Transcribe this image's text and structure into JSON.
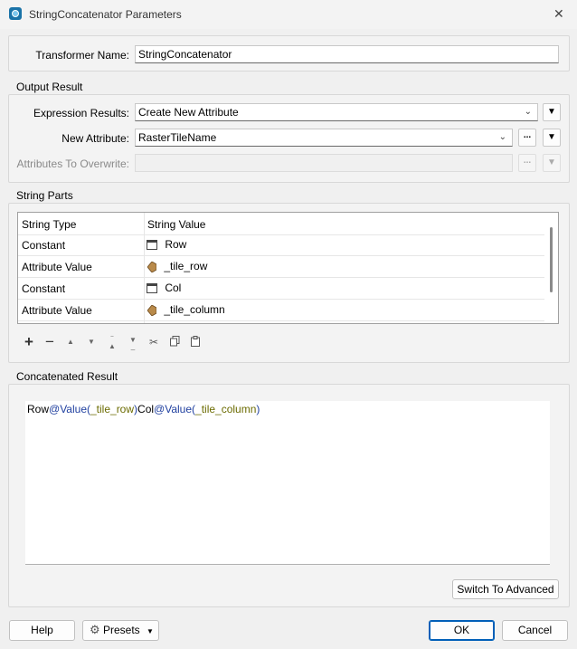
{
  "window": {
    "title": "StringConcatenator Parameters",
    "close_glyph": "✕"
  },
  "transformer": {
    "label": "Transformer Name:",
    "value": "StringConcatenator"
  },
  "output_result": {
    "section_title": "Output Result",
    "expression_results": {
      "label": "Expression Results:",
      "value": "Create New Attribute"
    },
    "new_attribute": {
      "label": "New Attribute:",
      "value": "RasterTileName",
      "ellipsis": "..."
    },
    "attributes_to_overwrite": {
      "label": "Attributes To Overwrite:",
      "value": "",
      "ellipsis": "..."
    }
  },
  "string_parts": {
    "section_title": "String Parts",
    "columns": [
      "String Type",
      "String Value"
    ],
    "rows": [
      {
        "type": "Constant",
        "value": "Row",
        "icon": "constant-icon"
      },
      {
        "type": "Attribute Value",
        "value": "_tile_row",
        "icon": "attribute-icon"
      },
      {
        "type": "Constant",
        "value": "Col",
        "icon": "constant-icon"
      },
      {
        "type": "Attribute Value",
        "value": "_tile_column",
        "icon": "attribute-icon"
      }
    ],
    "toolbar": [
      "add-icon",
      "remove-icon",
      "move-up-icon",
      "move-down-icon",
      "move-top-icon",
      "move-bottom-icon",
      "cut-icon",
      "copy-icon",
      "paste-icon"
    ]
  },
  "concatenated_result": {
    "section_title": "Concatenated Result",
    "tokens": [
      {
        "text": "Row",
        "kind": "text"
      },
      {
        "text": "@Value(",
        "kind": "fn"
      },
      {
        "text": "_tile_row",
        "kind": "attr"
      },
      {
        "text": ")",
        "kind": "fn"
      },
      {
        "text": "Col",
        "kind": "text"
      },
      {
        "text": "@Value(",
        "kind": "fn"
      },
      {
        "text": "_tile_column",
        "kind": "attr"
      },
      {
        "text": ")",
        "kind": "fn"
      }
    ],
    "switch_button": "Switch To Advanced"
  },
  "footer": {
    "help": "Help",
    "presets": "Presets",
    "ok": "OK",
    "cancel": "Cancel"
  },
  "colors": {
    "fn": "#1f3f9f",
    "attr": "#6b6b00",
    "accent": "#005fb8"
  }
}
